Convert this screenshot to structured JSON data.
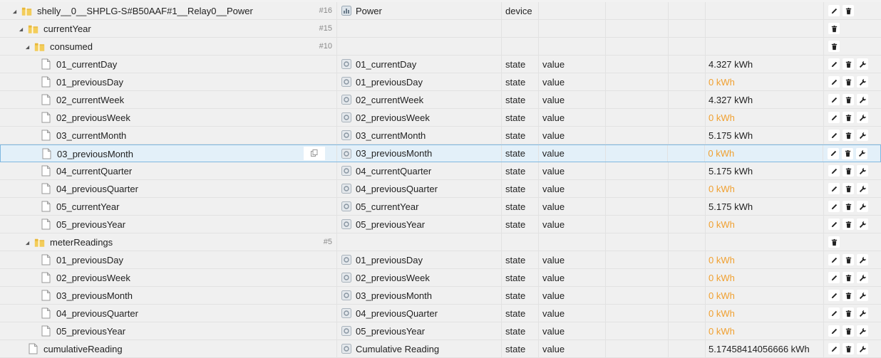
{
  "rows": [
    {
      "level": 0,
      "kind": "folder",
      "expanded": true,
      "id": "shelly__0__SHPLG-S#B50AAF#1__Relay0__Power",
      "count": "#16",
      "name": "Power",
      "name_icon": "device-icon",
      "type": "device",
      "role": "",
      "value": "",
      "zero": false,
      "actions": [
        "edit",
        "delete"
      ]
    },
    {
      "level": 1,
      "kind": "folder",
      "expanded": true,
      "id": "currentYear",
      "count": "#15",
      "name": "",
      "name_icon": "",
      "type": "",
      "role": "",
      "value": "",
      "zero": false,
      "actions": [
        "delete"
      ]
    },
    {
      "level": 2,
      "kind": "folder",
      "expanded": true,
      "id": "consumed",
      "count": "#10",
      "name": "",
      "name_icon": "",
      "type": "",
      "role": "",
      "value": "",
      "zero": false,
      "actions": [
        "delete"
      ]
    },
    {
      "level": 3,
      "kind": "file",
      "id": "01_currentDay",
      "count": "",
      "name": "01_currentDay",
      "name_icon": "state-icon",
      "type": "state",
      "role": "value",
      "value": "4.327 kWh",
      "zero": false,
      "actions": [
        "edit",
        "delete",
        "wrench"
      ]
    },
    {
      "level": 3,
      "kind": "file",
      "id": "01_previousDay",
      "count": "",
      "name": "01_previousDay",
      "name_icon": "state-icon",
      "type": "state",
      "role": "value",
      "value": "0 kWh",
      "zero": true,
      "actions": [
        "edit",
        "delete",
        "wrench"
      ]
    },
    {
      "level": 3,
      "kind": "file",
      "id": "02_currentWeek",
      "count": "",
      "name": "02_currentWeek",
      "name_icon": "state-icon",
      "type": "state",
      "role": "value",
      "value": "4.327 kWh",
      "zero": false,
      "actions": [
        "edit",
        "delete",
        "wrench"
      ]
    },
    {
      "level": 3,
      "kind": "file",
      "id": "02_previousWeek",
      "count": "",
      "name": "02_previousWeek",
      "name_icon": "state-icon",
      "type": "state",
      "role": "value",
      "value": "0 kWh",
      "zero": true,
      "actions": [
        "edit",
        "delete",
        "wrench"
      ]
    },
    {
      "level": 3,
      "kind": "file",
      "id": "03_currentMonth",
      "count": "",
      "name": "03_currentMonth",
      "name_icon": "state-icon",
      "type": "state",
      "role": "value",
      "value": "5.175 kWh",
      "zero": false,
      "actions": [
        "edit",
        "delete",
        "wrench"
      ]
    },
    {
      "level": 3,
      "kind": "file",
      "id": "03_previousMonth",
      "count": "",
      "name": "03_previousMonth",
      "name_icon": "state-icon",
      "type": "state",
      "role": "value",
      "value": "0 kWh",
      "zero": true,
      "selected": true,
      "actions": [
        "edit",
        "delete",
        "wrench"
      ]
    },
    {
      "level": 3,
      "kind": "file",
      "id": "04_currentQuarter",
      "count": "",
      "name": "04_currentQuarter",
      "name_icon": "state-icon",
      "type": "state",
      "role": "value",
      "value": "5.175 kWh",
      "zero": false,
      "actions": [
        "edit",
        "delete",
        "wrench"
      ]
    },
    {
      "level": 3,
      "kind": "file",
      "id": "04_previousQuarter",
      "count": "",
      "name": "04_previousQuarter",
      "name_icon": "state-icon",
      "type": "state",
      "role": "value",
      "value": "0 kWh",
      "zero": true,
      "actions": [
        "edit",
        "delete",
        "wrench"
      ]
    },
    {
      "level": 3,
      "kind": "file",
      "id": "05_currentYear",
      "count": "",
      "name": "05_currentYear",
      "name_icon": "state-icon",
      "type": "state",
      "role": "value",
      "value": "5.175 kWh",
      "zero": false,
      "actions": [
        "edit",
        "delete",
        "wrench"
      ]
    },
    {
      "level": 3,
      "kind": "file",
      "id": "05_previousYear",
      "count": "",
      "name": "05_previousYear",
      "name_icon": "state-icon",
      "type": "state",
      "role": "value",
      "value": "0 kWh",
      "zero": true,
      "actions": [
        "edit",
        "delete",
        "wrench"
      ]
    },
    {
      "level": 2,
      "kind": "folder",
      "expanded": true,
      "id": "meterReadings",
      "count": "#5",
      "name": "",
      "name_icon": "",
      "type": "",
      "role": "",
      "value": "",
      "zero": false,
      "actions": [
        "delete"
      ]
    },
    {
      "level": 3,
      "kind": "file",
      "id": "01_previousDay",
      "count": "",
      "name": "01_previousDay",
      "name_icon": "state-icon",
      "type": "state",
      "role": "value",
      "value": "0 kWh",
      "zero": true,
      "actions": [
        "edit",
        "delete",
        "wrench"
      ]
    },
    {
      "level": 3,
      "kind": "file",
      "id": "02_previousWeek",
      "count": "",
      "name": "02_previousWeek",
      "name_icon": "state-icon",
      "type": "state",
      "role": "value",
      "value": "0 kWh",
      "zero": true,
      "actions": [
        "edit",
        "delete",
        "wrench"
      ]
    },
    {
      "level": 3,
      "kind": "file",
      "id": "03_previousMonth",
      "count": "",
      "name": "03_previousMonth",
      "name_icon": "state-icon",
      "type": "state",
      "role": "value",
      "value": "0 kWh",
      "zero": true,
      "actions": [
        "edit",
        "delete",
        "wrench"
      ]
    },
    {
      "level": 3,
      "kind": "file",
      "id": "04_previousQuarter",
      "count": "",
      "name": "04_previousQuarter",
      "name_icon": "state-icon",
      "type": "state",
      "role": "value",
      "value": "0 kWh",
      "zero": true,
      "actions": [
        "edit",
        "delete",
        "wrench"
      ]
    },
    {
      "level": 3,
      "kind": "file",
      "id": "05_previousYear",
      "count": "",
      "name": "05_previousYear",
      "name_icon": "state-icon",
      "type": "state",
      "role": "value",
      "value": "0 kWh",
      "zero": true,
      "actions": [
        "edit",
        "delete",
        "wrench"
      ]
    },
    {
      "level": 1,
      "kind": "file",
      "id": "cumulativeReading",
      "count": "",
      "name": "Cumulative Reading",
      "name_icon": "state-icon",
      "type": "state",
      "role": "value",
      "value": "5.17458414056666 kWh",
      "zero": false,
      "actions": [
        "edit",
        "delete",
        "wrench"
      ]
    }
  ],
  "colors": {
    "zero_value": "#f0a030",
    "selected_row": "#e3f0f9",
    "folder": "#e8b83a"
  }
}
